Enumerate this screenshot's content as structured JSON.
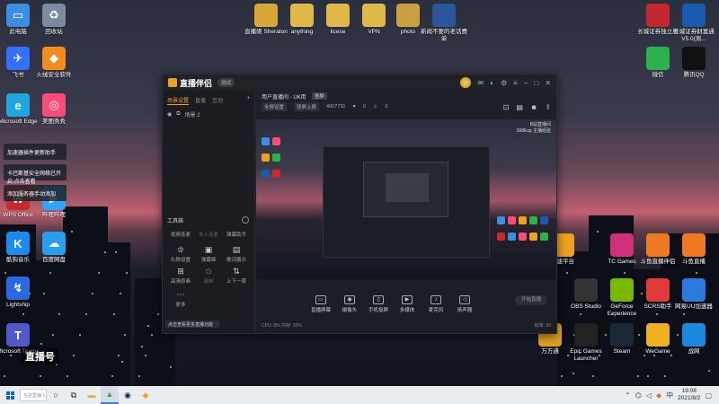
{
  "desktop": {
    "icons_left": [
      {
        "label": "此电脑",
        "color": "#3a8ee6",
        "glyph": "▭"
      },
      {
        "label": "回收站",
        "color": "#7d8aa0",
        "glyph": "♻"
      },
      {
        "label": "飞书",
        "color": "#3370ff",
        "glyph": "✈"
      },
      {
        "label": "火绒安全软件",
        "color": "#f28c1c",
        "glyph": "◆"
      },
      {
        "label": "Microsoft Edge",
        "color": "#1fa5e0",
        "glyph": "e"
      },
      {
        "label": "美图秀秀",
        "color": "#ff4a7a",
        "glyph": "◎"
      },
      {
        "label": "WPS Office",
        "color": "#c62a2a",
        "glyph": "W"
      },
      {
        "label": "哔哩哔哩",
        "color": "#2ea6ff",
        "glyph": "▶"
      },
      {
        "label": "酷狗音乐",
        "color": "#1a8cf0",
        "glyph": "K"
      },
      {
        "label": "百度网盘",
        "color": "#28a0f0",
        "glyph": "☁"
      },
      {
        "label": "Lightship",
        "color": "#2a6ae0",
        "glyph": "↯"
      },
      {
        "label": "Microsoft Teams",
        "color": "#5059c9",
        "glyph": "T"
      }
    ],
    "icons_top": [
      {
        "label": "直播姬 Sheraton",
        "color": "#d9a63a"
      },
      {
        "label": "anything",
        "color": "#e0b84a"
      },
      {
        "label": "licese",
        "color": "#e0b84a"
      },
      {
        "label": "VPN",
        "color": "#e0b84a"
      },
      {
        "label": "photo",
        "color": "#c9a040"
      },
      {
        "label": "新闻不要的老话费单",
        "color": "#2b579a"
      }
    ],
    "icons_right": [
      {
        "label": "长城证券独立版",
        "color": "#c0282e"
      },
      {
        "label": "长城证券财富通V5.0(测...",
        "color": "#1a5ab0"
      },
      {
        "label": "微信",
        "color": "#2bb24c"
      },
      {
        "label": "腾讯QQ",
        "color": "#111111"
      },
      {
        "label": "高速平台",
        "color": "#f0a020"
      },
      {
        "label": "TC Games",
        "color": "#d0307a"
      },
      {
        "label": "斗鱼直播伴侣",
        "color": "#f07820"
      },
      {
        "label": "斗鱼直播",
        "color": "#f07820"
      },
      {
        "label": "OBS Studio",
        "color": "#333"
      },
      {
        "label": "GeForce Experience",
        "color": "#76b900"
      },
      {
        "label": "SCRS助手",
        "color": "#e03a3a"
      },
      {
        "label": "网易UU加速器",
        "color": "#2a7ae0"
      },
      {
        "label": "万方通",
        "color": "#e0a020"
      },
      {
        "label": "Epic Games Launcher",
        "color": "#222"
      },
      {
        "label": "Steam",
        "color": "#1b2838"
      },
      {
        "label": "WeGame",
        "color": "#f0b020"
      },
      {
        "label": "战网",
        "color": "#1a8ae0"
      }
    ],
    "toasts": [
      "加速器插件更新助手",
      "卡巴斯基安全网络已开启,点击查看",
      "添加服务器手动添加"
    ],
    "watermark": "直播号"
  },
  "app": {
    "title": "直播伴侣",
    "version": "测试",
    "left_tabs": [
      "场景设置",
      "直播",
      "互动"
    ],
    "scene_row": "场景 2",
    "tools_header": "工具箱",
    "tools_row1": [
      "视频连麦",
      "多人连麦",
      "弹幕助手"
    ],
    "tools_row2": [
      "礼物设置",
      "弹幕姬",
      "歌词展示"
    ],
    "tools_row3": [
      "高清原画",
      "录制",
      "上下一首"
    ],
    "tools_row4": [
      "更多"
    ],
    "notice": "点击查看更多直播功能",
    "scene_bar": {
      "name": "用户直播间 - UK用",
      "tag": "竖屏"
    },
    "info_bar": {
      "tags": [
        "全屏设置",
        "竖屏上屏"
      ],
      "room": "4007731",
      "counts": [
        "0",
        "0"
      ]
    },
    "preview_text": [
      "B站直播间",
      "398Exp 主播经验"
    ],
    "controls": [
      "直播屏幕",
      "摄像头",
      "手机投屏",
      "多媒体",
      "麦克风",
      "扬声器"
    ],
    "start_label": "开始直播",
    "status_left": "CPU: 8%  内存: 25%",
    "status_right": "帧率: 30"
  },
  "taskbar": {
    "search_placeholder": "在这里输入",
    "time": "19:08",
    "date": "2021/8/2",
    "tray_lang": "中"
  }
}
